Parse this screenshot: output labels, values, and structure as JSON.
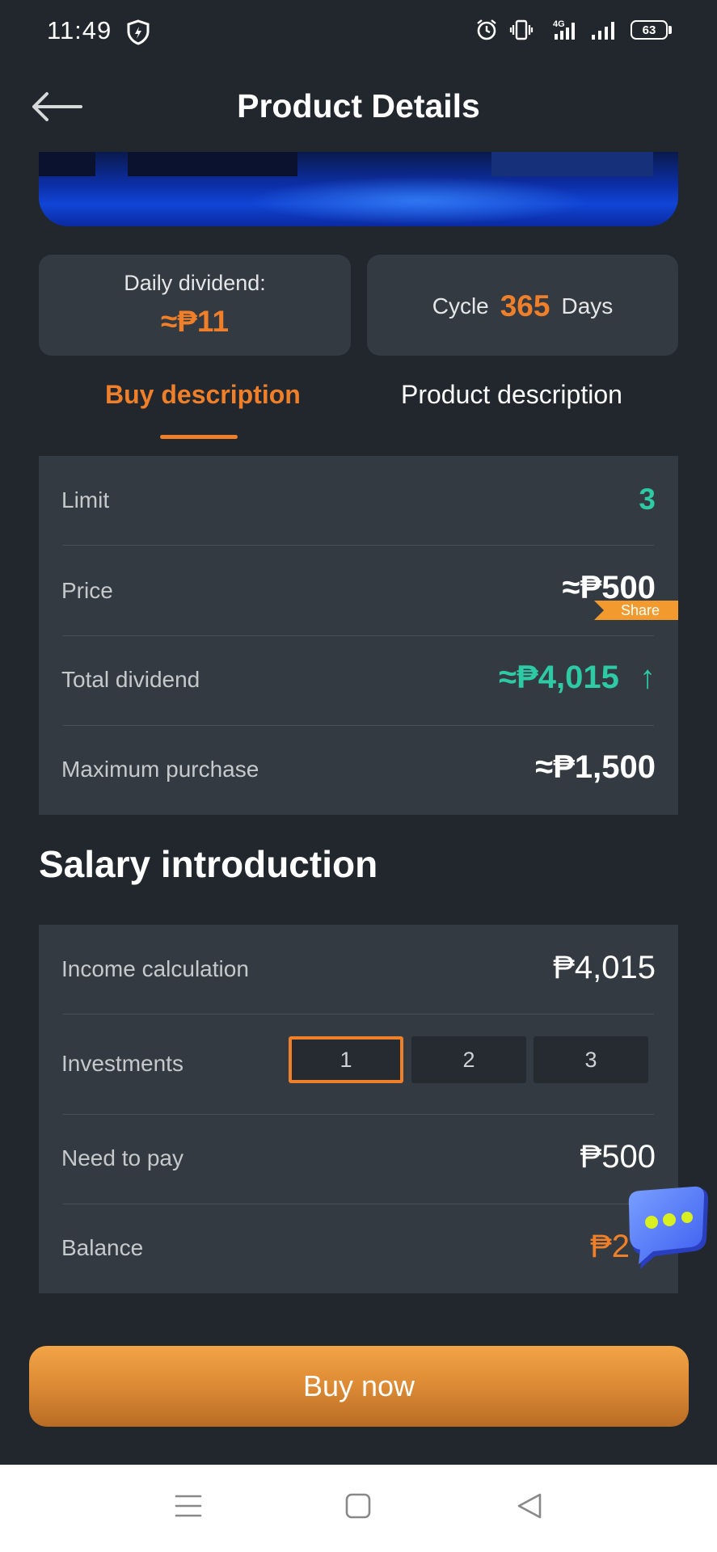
{
  "status_bar": {
    "time": "11:49",
    "network": "4G",
    "battery": "63",
    "icons": [
      "shield-icon",
      "alarm-icon",
      "vibrate-icon",
      "signal-4g-icon",
      "signal-icon",
      "battery-icon"
    ]
  },
  "header": {
    "title": "Product Details",
    "back_icon": "arrow-left-icon"
  },
  "summary": {
    "daily_dividend_label": "Daily dividend:",
    "daily_dividend_value": "≈₱11",
    "cycle_label": "Cycle",
    "cycle_value": "365",
    "cycle_unit": "Days"
  },
  "tabs": [
    {
      "label": "Buy description",
      "active": true
    },
    {
      "label": "Product description",
      "active": false
    }
  ],
  "buy_details": {
    "limit_label": "Limit",
    "limit_value": "3",
    "price_label": "Price",
    "price_value": "≈₱500",
    "share_badge": "Share",
    "total_dividend_label": "Total dividend",
    "total_dividend_value": "≈₱4,015",
    "total_dividend_trend": "↑",
    "max_purchase_label": "Maximum purchase",
    "max_purchase_value": "≈₱1,500"
  },
  "salary": {
    "title": "Salary introduction",
    "income_label": "Income calculation",
    "income_value": "₱4,015",
    "investments_label": "Investments",
    "investment_options": [
      "1",
      "2",
      "3"
    ],
    "selected_investment": "1",
    "need_to_pay_label": "Need to pay",
    "need_to_pay_value": "₱500",
    "balance_label": "Balance",
    "balance_value": "₱2"
  },
  "buy_button": {
    "label": "Buy now"
  },
  "nav": {
    "icons": [
      "menu-icon",
      "home-square-icon",
      "back-triangle-icon"
    ]
  },
  "colors": {
    "background": "#22272d",
    "card": "#343a41",
    "accent_orange": "#f07f2a",
    "accent_teal": "#2ec9a5"
  }
}
